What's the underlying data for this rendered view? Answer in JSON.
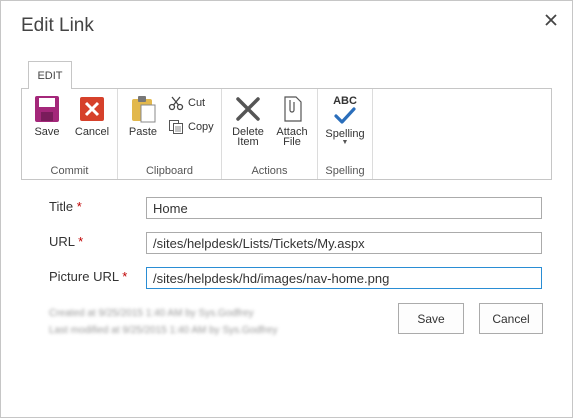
{
  "dialog": {
    "title": "Edit Link"
  },
  "ribbon": {
    "tab_label": "EDIT",
    "groups": {
      "commit": {
        "label": "Commit",
        "save": "Save",
        "cancel": "Cancel"
      },
      "clipboard": {
        "label": "Clipboard",
        "paste": "Paste",
        "cut": "Cut",
        "copy": "Copy"
      },
      "actions": {
        "label": "Actions",
        "delete_line1": "Delete",
        "delete_line2": "Item",
        "attach_line1": "Attach",
        "attach_line2": "File"
      },
      "spelling": {
        "label": "Spelling",
        "button": "Spelling",
        "abc": "ABC"
      }
    }
  },
  "form": {
    "title_label": "Title",
    "title_value": "Home",
    "url_label": "URL",
    "url_value": "/sites/helpdesk/Lists/Tickets/My.aspx",
    "picture_label": "Picture URL",
    "picture_value": "/sites/helpdesk/hd/images/nav-home.png",
    "required_mark": "*",
    "created_text": "Created at 9/25/2015 1:40 AM by Sys.Godfrey",
    "modified_text": "Last modified at 9/25/2015 1:40 AM by Sys.Godfrey",
    "save_button": "Save",
    "cancel_button": "Cancel"
  },
  "colors": {
    "required": "#bf0000",
    "focus_border": "#2a8dd4",
    "save_icon": "#a4277a",
    "cancel_icon": "#d6412b",
    "spell_check": "#2a6ebb"
  }
}
